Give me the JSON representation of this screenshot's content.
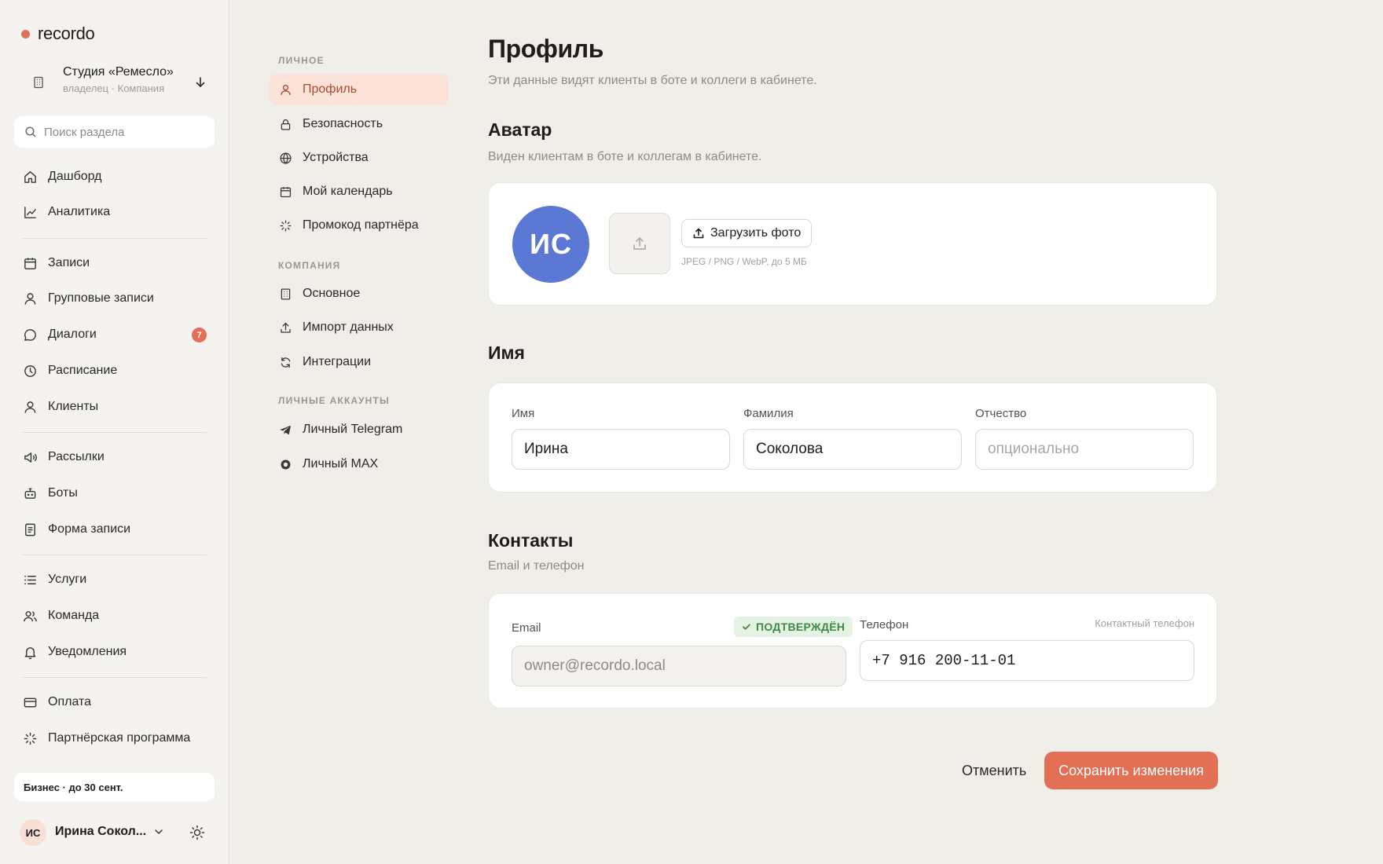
{
  "brand": {
    "name": "recordo",
    "accent": "#e46f55"
  },
  "org": {
    "name": "Студия «Ремесло»",
    "sub": "владелец · Компания"
  },
  "search": {
    "placeholder": "Поиск раздела"
  },
  "sidebar": {
    "items": [
      {
        "label": "Дашборд",
        "icon": "home-icon"
      },
      {
        "label": "Аналитика",
        "icon": "chart-icon"
      },
      {
        "label": "Записи",
        "icon": "calendar-icon"
      },
      {
        "label": "Групповые записи",
        "icon": "user-icon"
      },
      {
        "label": "Диалоги",
        "icon": "chat-icon",
        "badge": "7"
      },
      {
        "label": "Расписание",
        "icon": "clock-icon"
      },
      {
        "label": "Клиенты",
        "icon": "user-icon"
      },
      {
        "label": "Рассылки",
        "icon": "megaphone-icon"
      },
      {
        "label": "Боты",
        "icon": "bot-icon"
      },
      {
        "label": "Форма записи",
        "icon": "form-icon"
      },
      {
        "label": "Услуги",
        "icon": "list-icon"
      },
      {
        "label": "Команда",
        "icon": "team-icon"
      },
      {
        "label": "Уведомления",
        "icon": "bell-icon"
      },
      {
        "label": "Оплата",
        "icon": "card-icon"
      },
      {
        "label": "Партнёрская программа",
        "icon": "spark-icon"
      }
    ],
    "plan": "Бизнес · до 30 сент.",
    "user": {
      "initials": "ИС",
      "name": "Ирина Сокол..."
    }
  },
  "submenu": {
    "sections": [
      "ЛИЧНОЕ",
      "КОМПАНИЯ",
      "ЛИЧНЫЕ АККАУНТЫ"
    ],
    "items": [
      {
        "label": "Профиль",
        "active": true
      },
      {
        "label": "Безопасность"
      },
      {
        "label": "Устройства"
      },
      {
        "label": "Мой календарь"
      },
      {
        "label": "Промокод партнёра"
      },
      {
        "label": "Основное"
      },
      {
        "label": "Импорт данных"
      },
      {
        "label": "Интеграции"
      },
      {
        "label": "Личный Telegram"
      },
      {
        "label": "Личный MAX"
      }
    ]
  },
  "page": {
    "title": "Профиль",
    "subtitle": "Эти данные видят клиенты в боте и коллеги в кабинете."
  },
  "avatar": {
    "title": "Аватар",
    "subtitle": "Виден клиентам в боте и коллегам в кабинете.",
    "initials": "ИС",
    "upload_label": "Загрузить фото",
    "hint": "JPEG / PNG / WebP, до 5 МБ"
  },
  "name": {
    "title": "Имя",
    "first": {
      "label": "Имя",
      "value": "Ирина"
    },
    "last": {
      "label": "Фамилия",
      "value": "Соколова"
    },
    "middle": {
      "label": "Отчество",
      "value": "",
      "placeholder": "опционально"
    }
  },
  "contacts": {
    "title": "Контакты",
    "subtitle": "Email и телефон",
    "email": {
      "label": "Email",
      "value": "owner@recordo.local",
      "status": "ПОДТВЕРЖДЁН"
    },
    "phone": {
      "label": "Телефон",
      "value": "+7 916 200-11-01",
      "hint": "Контактный телефон"
    }
  },
  "actions": {
    "cancel": "Отменить",
    "save": "Сохранить изменения"
  }
}
